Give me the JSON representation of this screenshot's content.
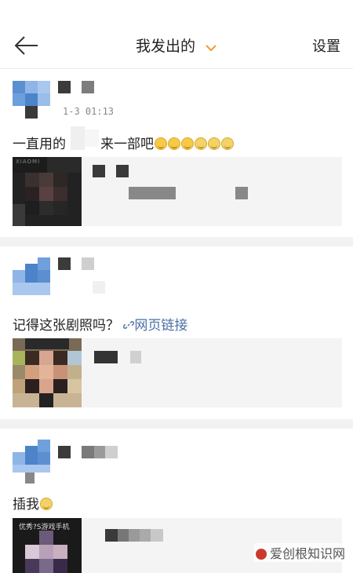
{
  "header": {
    "title": "我发出的",
    "settings_label": "设置"
  },
  "posts": [
    {
      "timestamp": "1-3 01:13",
      "text": "一直用的",
      "text_tail": "来一部吧",
      "card_label": "XIAOMI"
    },
    {
      "text": "记得这张剧照吗？",
      "link_text": "网页链接"
    },
    {
      "text": "插我",
      "card_label": "优秀?S游戏手机"
    }
  ],
  "watermark": "爱创根知识网",
  "colors": {
    "link": "#4a6fa5",
    "accent": "#f29a2e",
    "separator": "#f2f2f2",
    "card_bg": "#f4f4f4"
  }
}
